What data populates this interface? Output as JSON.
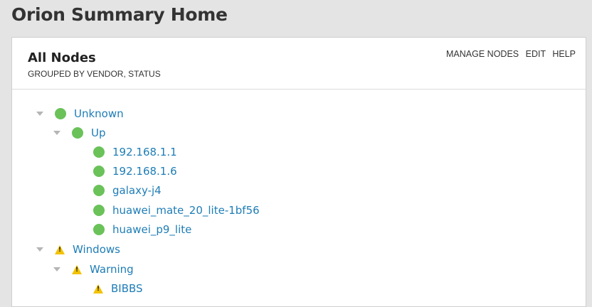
{
  "page": {
    "title": "Orion Summary Home"
  },
  "panel": {
    "title": "All Nodes",
    "subtitle": "GROUPED BY VENDOR, STATUS",
    "actions": {
      "manage": "MANAGE NODES",
      "edit": "EDIT",
      "help": "HELP"
    }
  },
  "tree": {
    "groups": [
      {
        "label": "Unknown",
        "status": "up"
      },
      {
        "label": "Up",
        "status": "up"
      },
      {
        "label": "192.168.1.1",
        "status": "up"
      },
      {
        "label": "192.168.1.6",
        "status": "up"
      },
      {
        "label": "galaxy-j4",
        "status": "up"
      },
      {
        "label": "huawei_mate_20_lite-1bf56",
        "status": "up"
      },
      {
        "label": "huawei_p9_lite",
        "status": "up"
      },
      {
        "label": "Windows",
        "status": "warning"
      },
      {
        "label": "Warning",
        "status": "warning"
      },
      {
        "label": "BIBBS",
        "status": "warning"
      }
    ]
  },
  "colors": {
    "status_up": "#6ac259",
    "status_warning": "#f2c200",
    "link": "#1e7db6"
  }
}
